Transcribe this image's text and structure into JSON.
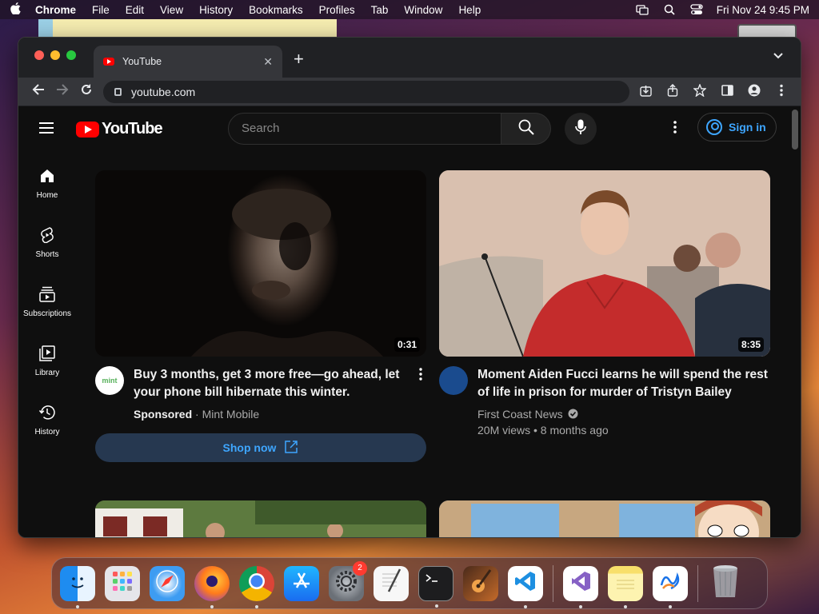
{
  "menubar": {
    "app": "Chrome",
    "items": [
      "File",
      "Edit",
      "View",
      "History",
      "Bookmarks",
      "Profiles",
      "Tab",
      "Window",
      "Help"
    ],
    "clock": "Fri Nov 24  9:45 PM"
  },
  "browser": {
    "tab_title": "YouTube",
    "url": "youtube.com"
  },
  "youtube": {
    "logo_text": "YouTube",
    "search_placeholder": "Search",
    "sign_in": "Sign in",
    "sidebar": [
      {
        "label": "Home",
        "icon": "home-icon"
      },
      {
        "label": "Shorts",
        "icon": "shorts-icon"
      },
      {
        "label": "Subscriptions",
        "icon": "subscriptions-icon"
      },
      {
        "label": "Library",
        "icon": "library-icon"
      },
      {
        "label": "History",
        "icon": "history-icon"
      }
    ],
    "videos": [
      {
        "duration": "0:31",
        "title": "Buy 3 months, get 3 more free—go ahead, let your phone bill hibernate this winter.",
        "sponsored": "Sponsored",
        "channel": "Mint Mobile",
        "avatar_text": "mint",
        "cta": "Shop now"
      },
      {
        "duration": "8:35",
        "title": "Moment Aiden Fucci learns he will spend the rest of life in prison for murder of Tristyn Bailey",
        "channel": "First Coast News",
        "stats": "20M views • 8 months ago"
      }
    ]
  },
  "dock": {
    "apps": [
      "Finder",
      "Launchpad",
      "Safari",
      "Firefox",
      "Chrome",
      "App Store",
      "System Settings",
      "TextEdit",
      "Terminal",
      "GarageBand",
      "VS Code",
      "Visual Studio",
      "Notes",
      "Freeform",
      "Trash"
    ],
    "settings_badge": "2"
  },
  "colors": {
    "yt_red": "#ff0000",
    "link_blue": "#3ea6ff",
    "bg_dark": "#0f0f0f"
  }
}
